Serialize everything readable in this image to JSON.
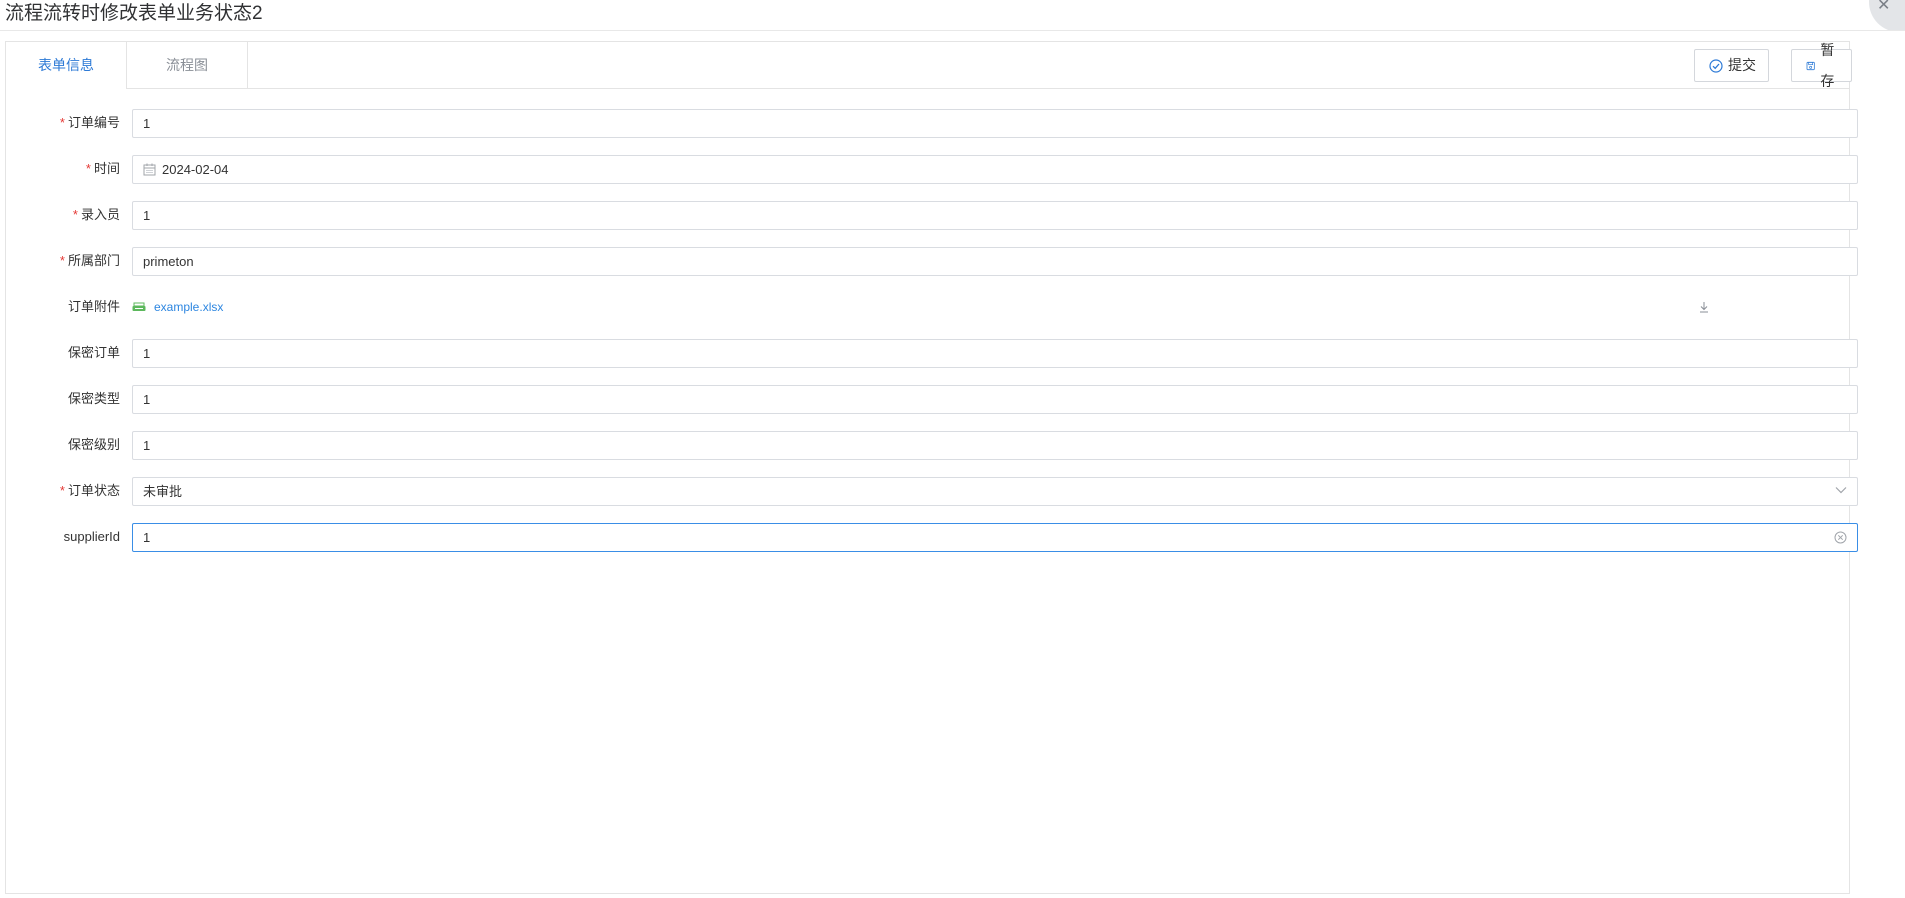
{
  "dialog": {
    "title": "流程流转时修改表单业务状态2"
  },
  "tabs": [
    {
      "label": "表单信息",
      "active": true
    },
    {
      "label": "流程图",
      "active": false
    }
  ],
  "toolbar": {
    "submit_label": "提交",
    "save_draft_label": "暂存"
  },
  "form": {
    "order_no": {
      "label": "订单编号",
      "required": true,
      "value": "1"
    },
    "time": {
      "label": "时间",
      "required": true,
      "value": "2024-02-04"
    },
    "entry_clerk": {
      "label": "录入员",
      "required": true,
      "value": "1"
    },
    "department": {
      "label": "所属部门",
      "required": true,
      "value": "primeton"
    },
    "attachment": {
      "label": "订单附件",
      "required": false,
      "file_name": "example.xlsx"
    },
    "confidential_order": {
      "label": "保密订单",
      "required": false,
      "value": "1"
    },
    "confidential_type": {
      "label": "保密类型",
      "required": false,
      "value": "1"
    },
    "confidential_level": {
      "label": "保密级别",
      "required": false,
      "value": "1"
    },
    "order_status": {
      "label": "订单状态",
      "required": true,
      "value": "未审批"
    },
    "supplier_id": {
      "label": "supplierId",
      "required": false,
      "value": "1"
    }
  },
  "required_mark": "*",
  "colors": {
    "accent": "#2d7ad6",
    "required": "#e53935",
    "border": "#d9dce1",
    "focus": "#3a8ee6",
    "attachment_icon": "#5cb85c"
  }
}
